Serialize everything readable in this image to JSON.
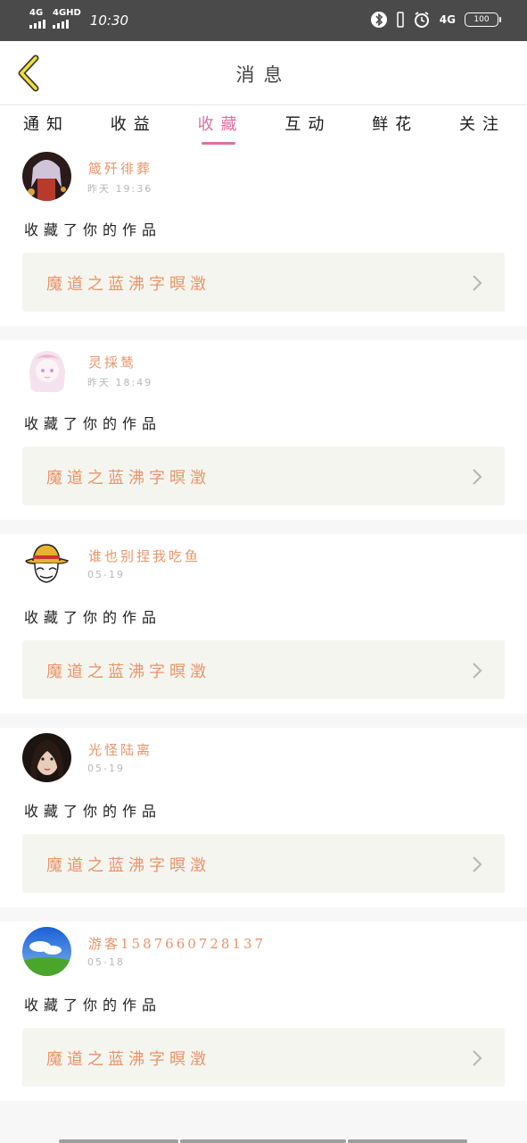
{
  "status_bar": {
    "sim1": "4G",
    "sim2": "4GHD",
    "time": "10:30",
    "network": "4G",
    "battery": "100"
  },
  "header": {
    "title": "消息",
    "back_icon": "chevron-left-icon"
  },
  "tabs": [
    {
      "label": "通知",
      "active": false
    },
    {
      "label": "收益",
      "active": false
    },
    {
      "label": "收藏",
      "active": true
    },
    {
      "label": "互动",
      "active": false
    },
    {
      "label": "鲜花",
      "active": false
    },
    {
      "label": "关注",
      "active": false
    }
  ],
  "colors": {
    "accent_pink": "#e06fa3",
    "name_orange": "#e8946a",
    "card_bg": "#f5f5ef"
  },
  "notifications": [
    {
      "user": "箴歼徘葬",
      "time": "昨天 19:36",
      "action": "收藏了你的作品",
      "work": "魔道之蓝沸字暝澂",
      "avatar": "anime-girl-dark"
    },
    {
      "user": "灵採鸶",
      "time": "昨天 18:49",
      "action": "收藏了你的作品",
      "work": "魔道之蓝沸字暝澂",
      "avatar": "anime-girl-light"
    },
    {
      "user": "谁也别捏我吃鱼",
      "time": "05-19",
      "action": "收藏了你的作品",
      "work": "魔道之蓝沸字暝澂",
      "avatar": "straw-hat-boy"
    },
    {
      "user": "光怪陆离",
      "time": "05-19",
      "action": "收藏了你的作品",
      "work": "魔道之蓝沸字暝澂",
      "avatar": "girl-photo"
    },
    {
      "user": "游客1587660728137",
      "time": "05-18",
      "action": "收藏了你的作品",
      "work": "魔道之蓝沸字暝澂",
      "avatar": "sky-landscape"
    }
  ]
}
